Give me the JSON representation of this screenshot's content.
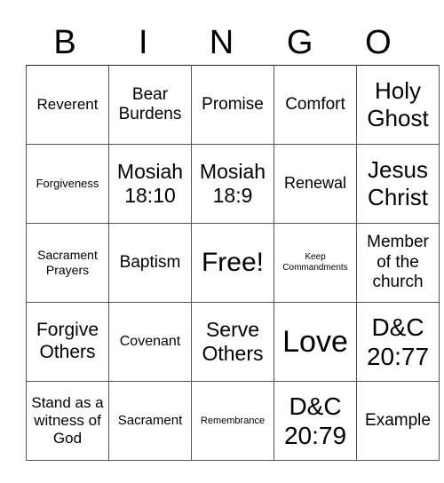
{
  "header": {
    "letters": [
      "B",
      "I",
      "N",
      "G",
      "O"
    ]
  },
  "board": {
    "rows": [
      [
        "Reverent",
        "Bear Burdens",
        "Promise",
        "Comfort",
        "Holy Ghost"
      ],
      [
        "Forgiveness",
        "Mosiah 18:10",
        "Mosiah 18:9",
        "Renewal",
        "Jesus Christ"
      ],
      [
        "Sacrament Prayers",
        "Baptism",
        "Free!",
        "Keep Commandments",
        "Member of the church"
      ],
      [
        "Forgive Others",
        "Covenant",
        "Serve Others",
        "Love",
        "D&C 20:77"
      ],
      [
        "Stand as a witness of God",
        "Sacrament",
        "Remembrance",
        "D&C 20:79",
        "Example"
      ]
    ]
  }
}
